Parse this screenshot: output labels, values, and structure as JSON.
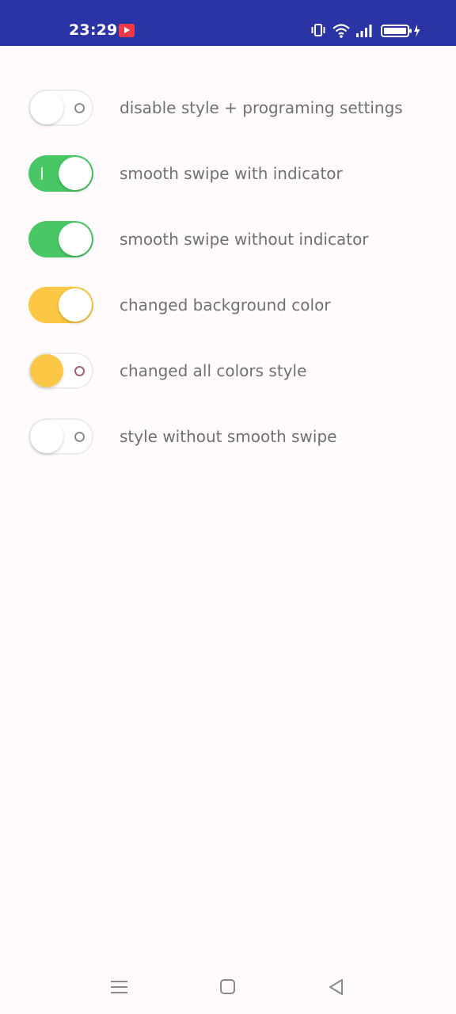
{
  "status_bar": {
    "time": "23:29",
    "icons": [
      "video-notification-icon",
      "vibrate-icon",
      "wifi-icon",
      "signal-icon",
      "battery-charging-icon"
    ],
    "background_color": "#2b34a5"
  },
  "switches": [
    {
      "label": "disable style + programing settings",
      "state": "off",
      "style": "default"
    },
    {
      "label": "smooth swipe with indicator",
      "state": "on",
      "style": "green-with-indicator"
    },
    {
      "label": "smooth swipe without indicator",
      "state": "on",
      "style": "green"
    },
    {
      "label": "changed background color",
      "state": "on",
      "style": "yellow"
    },
    {
      "label": "changed all colors style",
      "state": "off",
      "style": "yellow-knob"
    },
    {
      "label": "style without smooth swipe",
      "state": "off",
      "style": "default"
    }
  ],
  "colors": {
    "green": "#48c764",
    "yellow": "#fbc744",
    "label_text": "#707070",
    "background": "#fffbfd"
  },
  "nav_bar": {
    "icons": [
      "menu-icon",
      "home-icon",
      "back-icon"
    ]
  }
}
